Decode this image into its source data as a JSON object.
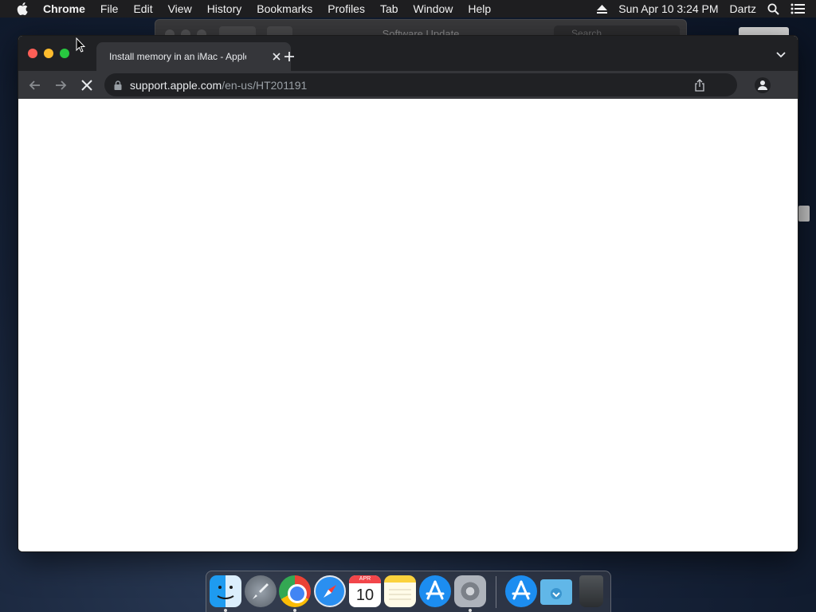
{
  "menubar": {
    "apple_icon": "apple-logo-icon",
    "items": [
      "Chrome",
      "File",
      "Edit",
      "View",
      "History",
      "Bookmarks",
      "Profiles",
      "Tab",
      "Window",
      "Help"
    ],
    "date_time": "Sun Apr 10  3:24 PM",
    "user": "Dartz",
    "status_icons": [
      "eject-icon",
      "spotlight-search-icon",
      "control-center-list-icon"
    ]
  },
  "background_window": {
    "title": "Software Update",
    "search_placeholder": "Search"
  },
  "chrome": {
    "tab": {
      "title": "Install memory in an iMac - Apple Support",
      "state": "loading"
    },
    "toolbar": {
      "url_host": "support.apple.com",
      "url_path": "/en-us/HT201191",
      "secure": true
    },
    "colors": {
      "tabstrip": "#202124",
      "toolbar": "#35363a",
      "omnibox": "#202124",
      "close": "#fe5f57",
      "minimize": "#febc2e",
      "maximize": "#28c840"
    }
  },
  "dock": {
    "apps": [
      {
        "name": "Finder",
        "running": true
      },
      {
        "name": "Launchpad",
        "running": false
      },
      {
        "name": "Google Chrome",
        "running": true
      },
      {
        "name": "Safari",
        "running": false
      },
      {
        "name": "Calendar",
        "running": false,
        "month": "APR",
        "day": "10"
      },
      {
        "name": "Notes",
        "running": false
      },
      {
        "name": "App Store",
        "running": false
      },
      {
        "name": "System Preferences",
        "running": true
      },
      {
        "name": "App Store",
        "running": false
      },
      {
        "name": "Downloads",
        "running": false
      },
      {
        "name": "Trash",
        "running": false
      }
    ]
  }
}
